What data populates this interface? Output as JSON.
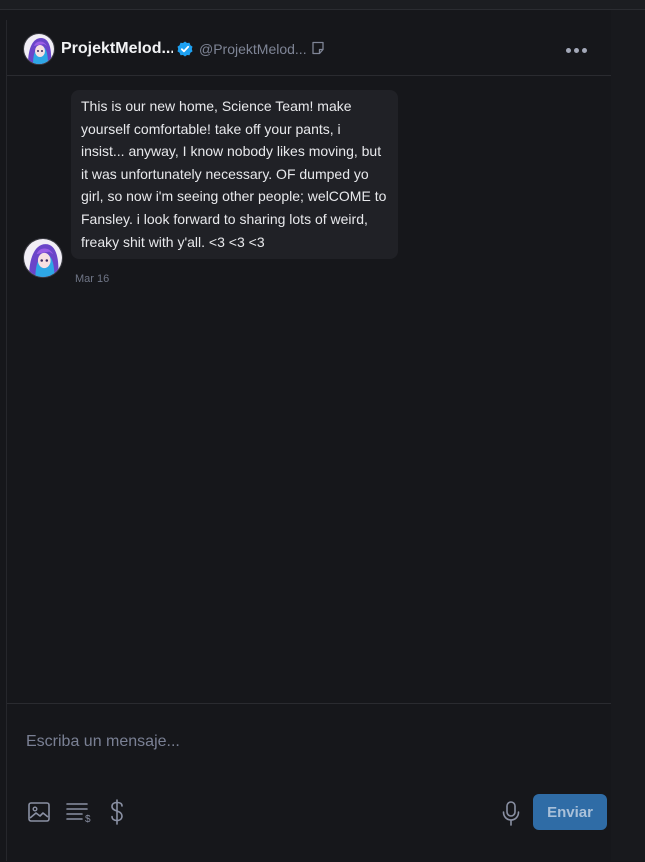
{
  "colors": {
    "background": "#16171b",
    "bubble": "#202126",
    "send_button": "#2f6ca6",
    "verified": "#1da1f2"
  },
  "header": {
    "display_name": "ProjektMelod...",
    "username": "@ProjektMelod...",
    "icons": [
      "avatar",
      "verified-icon",
      "note-icon",
      "more-icon"
    ]
  },
  "messages": [
    {
      "text": "This is our new home, Science Team! make yourself comfortable! take off your pants, i insist... anyway, I know nobody likes moving, but it was unfortunately necessary. OF dumped yo girl, so now i'm seeing other people; welCOME to Fansley. i look forward to sharing lots of weird, freaky shit with y'all. <3 <3 <3",
      "date": "Mar 16"
    }
  ],
  "composer": {
    "placeholder": "Escriba un mensaje...",
    "value": "",
    "send_label": "Enviar",
    "icons": [
      "image-icon",
      "pricing-icon",
      "dollar-icon",
      "mic-icon"
    ]
  }
}
